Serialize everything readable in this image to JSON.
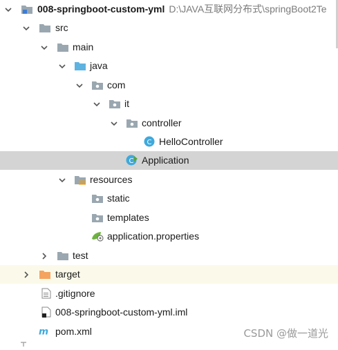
{
  "project": {
    "name": "008-springboot-custom-yml",
    "path": "D:\\JAVA互联网分布式\\springBoot2Te"
  },
  "nodes": {
    "src": "src",
    "main": "main",
    "java": "java",
    "com": "com",
    "it": "it",
    "controller": "controller",
    "hello_controller": "HelloController",
    "application": "Application",
    "resources": "resources",
    "static": "static",
    "templates": "templates",
    "application_properties": "application.properties",
    "test": "test",
    "target": "target",
    "gitignore": ".gitignore",
    "iml": "008-springboot-custom-yml.iml",
    "pom": "pom.xml"
  },
  "watermark": "CSDN @做一道光",
  "colors": {
    "selected_row": "#d4d4d4",
    "excluded_row": "#fbfaea",
    "folder_grey": "#9aa7b0",
    "source_folder": "#5fb3e0",
    "target_folder": "#f4a460",
    "class_icon": "#3fa9dc"
  }
}
